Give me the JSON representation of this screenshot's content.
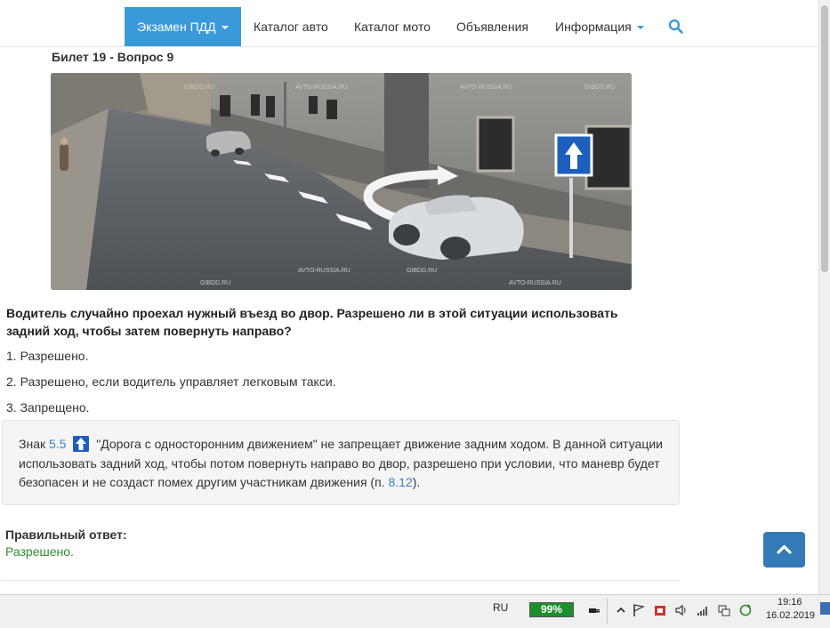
{
  "nav": {
    "exam": "Экзамен ПДД",
    "catalog_auto": "Каталог авто",
    "catalog_moto": "Каталог мото",
    "ads": "Объявления",
    "info": "Информация"
  },
  "ticket_title": "Билет 19 - Вопрос 9",
  "scene": {
    "watermarks": [
      "GIBDD.RU",
      "AVTO-RUSSIA.RU",
      "AVTO-RUSSIA.RU",
      "GIBDD.RU",
      "GIBDD.RU",
      "AVTO-RUSSIA.RU",
      "GIBDD.RU",
      "AVTO-RUSSIA.RU"
    ]
  },
  "question": "Водитель случайно проехал нужный въезд во двор. Разрешено ли в этой ситуации использовать задний ход, чтобы затем повернуть направо?",
  "answers": [
    "1. Разрешено.",
    "2. Разрешено, если водитель управляет легковым такси.",
    "3. Запрещено."
  ],
  "explanation": {
    "prefix": "Знак",
    "sign_link": "5.5",
    "sign_name": "\"Дорога с односторонним движением\" не запрещает движение задним ходом. В данной ситуации использовать задний ход, чтобы потом повернуть направо во двор, разрешено при условии, что маневр будет безопасен и не создаст помех другим участникам движения (п.",
    "rule_link": "8.12",
    "suffix": ")."
  },
  "correct": {
    "label": "Правильный ответ:",
    "value": "Разрешено."
  },
  "taskbar": {
    "lang": "RU",
    "battery": "99%",
    "time": "19:16",
    "date": "16.02.2019"
  },
  "colors": {
    "accent": "#3a9ad9",
    "correct": "#2e8b2e",
    "to_top": "#337ab7"
  }
}
